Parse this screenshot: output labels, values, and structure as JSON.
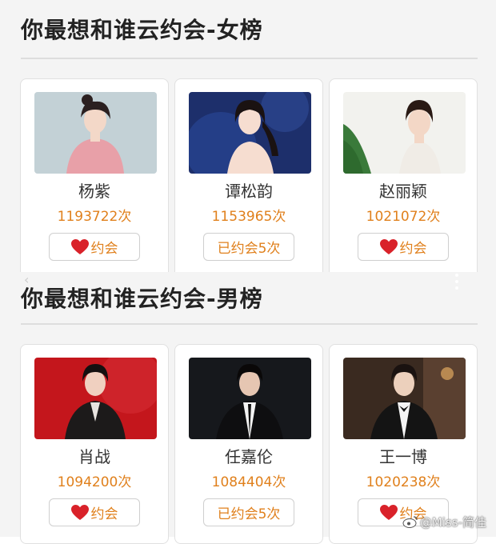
{
  "female_section": {
    "title": "你最想和谁云约会-女榜",
    "cards": [
      {
        "name": "杨紫",
        "count": "1193722次",
        "button": {
          "label": "约会",
          "state": "heart",
          "icon": "heart-icon"
        }
      },
      {
        "name": "谭松韵",
        "count": "1153965次",
        "button": {
          "label": "已约会5次",
          "state": "done"
        }
      },
      {
        "name": "赵丽颖",
        "count": "1021072次",
        "button": {
          "label": "约会",
          "state": "heart",
          "icon": "heart-icon"
        }
      }
    ]
  },
  "male_section": {
    "title": "你最想和谁云约会-男榜",
    "cards": [
      {
        "name": "肖战",
        "count": "1094200次",
        "button": {
          "label": "约会",
          "state": "heart",
          "icon": "heart-icon"
        }
      },
      {
        "name": "任嘉伦",
        "count": "1084404次",
        "button": {
          "label": "已约会5次",
          "state": "done"
        }
      },
      {
        "name": "王一博",
        "count": "1020238次",
        "button": {
          "label": "约会",
          "state": "heart",
          "icon": "heart-icon"
        }
      }
    ]
  },
  "watermark": {
    "text": "@Miss-简佳",
    "icon": "weibo-icon"
  },
  "colors": {
    "accent": "#e0801c",
    "heart": "#d9222a",
    "background": "#f4f4f4",
    "card": "#ffffff",
    "divider": "#dddddd"
  }
}
